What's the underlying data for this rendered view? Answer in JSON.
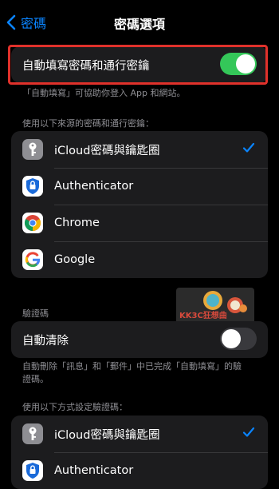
{
  "nav": {
    "back_label": "密碼",
    "title": "密碼選項"
  },
  "autofill": {
    "label": "自動填寫密碼和通行密鑰",
    "enabled": true
  },
  "autofill_caption": "「自動填寫」可協助你登入 App 和網站。",
  "sources_header": "使用以下來源的密碼和通行密鑰：",
  "sources": [
    {
      "label": "iCloud密碼與鑰匙圈",
      "icon": "keys-icon",
      "checked": true
    },
    {
      "label": "Authenticator",
      "icon": "authenticator-icon",
      "checked": false
    },
    {
      "label": "Chrome",
      "icon": "chrome-icon",
      "checked": false
    },
    {
      "label": "Google",
      "icon": "google-icon",
      "checked": false
    }
  ],
  "codes_header": "驗證碼",
  "auto_clear": {
    "label": "自動清除",
    "enabled": false
  },
  "auto_clear_caption": "自動刪除「訊息」和「郵件」中已完成「自動填寫」的驗證碼。",
  "setup_header": "使用以下方式設定驗證碼：",
  "setup_sources": [
    {
      "label": "iCloud密碼與鑰匙圈",
      "icon": "keys-icon",
      "checked": true
    },
    {
      "label": "Authenticator",
      "icon": "authenticator-icon",
      "checked": false
    }
  ],
  "watermark": {
    "text": "KK3C狂想曲"
  },
  "colors": {
    "accent": "#0a84ff",
    "toggle_on": "#34c759",
    "highlight": "#e0312b"
  }
}
